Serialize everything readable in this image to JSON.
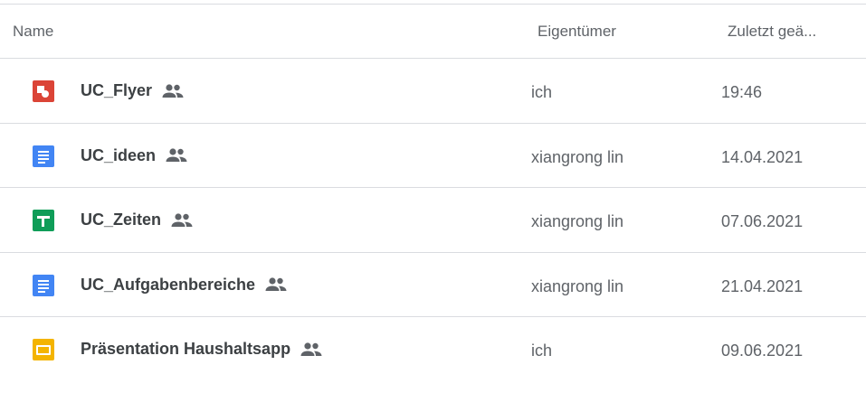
{
  "header": {
    "name": "Name",
    "owner": "Eigentümer",
    "modified": "Zuletzt geä..."
  },
  "files": [
    {
      "name": "UC_Flyer",
      "type": "drawing",
      "icon": "drawing-icon",
      "owner": "ich",
      "modified": "19:46",
      "shared": true,
      "color": "#db4437"
    },
    {
      "name": "UC_ideen",
      "type": "document",
      "icon": "docs-icon",
      "owner": "xiangrong lin",
      "modified": "14.04.2021",
      "shared": true,
      "color": "#4285f4"
    },
    {
      "name": "UC_Zeiten",
      "type": "spreadsheet",
      "icon": "sheets-icon",
      "owner": "xiangrong lin",
      "modified": "07.06.2021",
      "shared": true,
      "color": "#0f9d58"
    },
    {
      "name": "UC_Aufgabenbereiche",
      "type": "document",
      "icon": "docs-icon",
      "owner": "xiangrong lin",
      "modified": "21.04.2021",
      "shared": true,
      "color": "#4285f4"
    },
    {
      "name": "Präsentation Haushaltsapp",
      "type": "presentation",
      "icon": "slides-icon",
      "owner": "ich",
      "modified": "09.06.2021",
      "shared": true,
      "color": "#f4b400"
    }
  ]
}
